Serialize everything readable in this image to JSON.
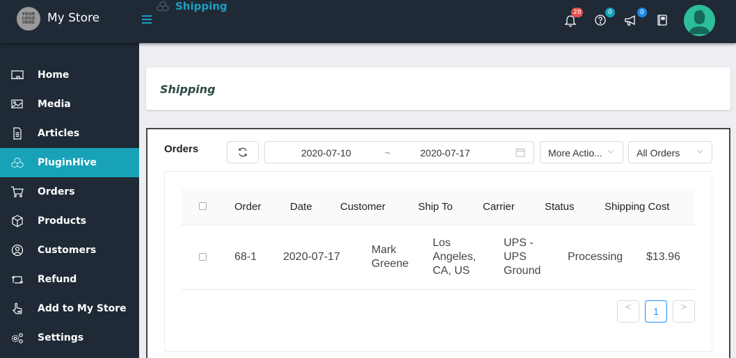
{
  "header": {
    "logo_text": [
      "YOUR",
      "LOGO",
      "HERE"
    ],
    "store_name": "My Store",
    "breadcrumb_title": "Shipping",
    "notifications": {
      "icon": "bell-icon",
      "count": "28",
      "color": "#e0504d"
    },
    "help": {
      "icon": "question-circle-icon",
      "count": "0",
      "color": "#17a2b8"
    },
    "announcements": {
      "icon": "megaphone-icon",
      "count": "0",
      "color": "#1e88e5"
    },
    "docs": {
      "icon": "book-icon"
    },
    "avatar": {
      "icon": "user-avatar-icon"
    }
  },
  "sidebar": {
    "items": [
      {
        "label": "Home",
        "icon": "monitor-icon",
        "active": false
      },
      {
        "label": "Media",
        "icon": "image-icon",
        "active": false
      },
      {
        "label": "Articles",
        "icon": "document-icon",
        "active": false
      },
      {
        "label": "PluginHive",
        "icon": "cubes-icon",
        "active": true
      },
      {
        "label": "Orders",
        "icon": "cart-icon",
        "active": false
      },
      {
        "label": "Products",
        "icon": "box-icon",
        "active": false
      },
      {
        "label": "Customers",
        "icon": "user-circle-icon",
        "active": false
      },
      {
        "label": "Refund",
        "icon": "refund-arrows-icon",
        "active": false
      },
      {
        "label": "Add to My Store",
        "icon": "pointer-hand-icon",
        "active": false
      },
      {
        "label": "Settings",
        "icon": "gears-icon",
        "active": false
      }
    ],
    "accent": "#17a2b8"
  },
  "page": {
    "title": "Shipping"
  },
  "orders": {
    "title": "Orders",
    "date_start": "2020-07-10",
    "date_separator": "~",
    "date_end": "2020-07-17",
    "more_actions": "More Actio...",
    "filter": "All Orders",
    "columns": [
      "Order",
      "Date",
      "Customer",
      "Ship To",
      "Carrier",
      "Status",
      "Shipping Cost"
    ],
    "rows": [
      {
        "order": "68-1",
        "date": "2020-07-17",
        "customer": [
          "Mark",
          "Greene"
        ],
        "ship_to": [
          "Los",
          "Angeles,",
          "CA, US"
        ],
        "carrier": [
          "UPS -",
          "UPS",
          "Ground"
        ],
        "status": "Processing",
        "shipping_cost": "$13.96"
      }
    ],
    "pagination": {
      "prev": "<",
      "current": "1",
      "next": ">"
    }
  }
}
